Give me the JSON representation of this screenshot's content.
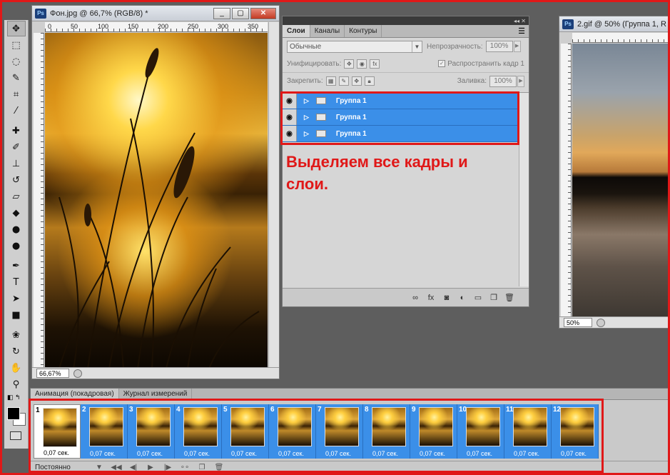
{
  "doc1": {
    "title": "Фон.jpg @ 66,7% (RGB/8) *",
    "zoom": "66,67%",
    "ruler": [
      "0",
      "50",
      "100",
      "150",
      "200",
      "250",
      "300",
      "350"
    ]
  },
  "doc2": {
    "title": "2.gif @ 50% (Группа 1, R",
    "zoom": "50%"
  },
  "layers_panel": {
    "tabs": [
      "Слои",
      "Каналы",
      "Контуры"
    ],
    "blend_mode": "Обычные",
    "opacity_label": "Непрозрачность:",
    "opacity_value": "100%",
    "unify_label": "Унифицировать:",
    "propagate_label": "Распространить кадр 1",
    "lock_label": "Закрепить:",
    "fill_label": "Заливка:",
    "fill_value": "100%",
    "layers": [
      "Группа 1",
      "Группа 1",
      "Группа 1"
    ]
  },
  "annotation": "Выделяем все кадры и слои.",
  "animation_panel": {
    "tabs": [
      "Анимация (покадровая)",
      "Журнал измерений"
    ],
    "frames": [
      {
        "n": "1",
        "t": "0,07 сек."
      },
      {
        "n": "2",
        "t": "0,07 сек."
      },
      {
        "n": "3",
        "t": "0,07 сек."
      },
      {
        "n": "4",
        "t": "0,07 сек."
      },
      {
        "n": "5",
        "t": "0,07 сек."
      },
      {
        "n": "6",
        "t": "0,07 сек."
      },
      {
        "n": "7",
        "t": "0,07 сек."
      },
      {
        "n": "8",
        "t": "0,07 сек."
      },
      {
        "n": "9",
        "t": "0,07 сек."
      },
      {
        "n": "10",
        "t": "0,07 сек."
      },
      {
        "n": "11",
        "t": "0,07 сек."
      },
      {
        "n": "12",
        "t": "0,07 сек."
      }
    ],
    "loop": "Постоянно"
  },
  "colors": {
    "selection": "#3b8fe8",
    "highlight": "#e01818"
  }
}
